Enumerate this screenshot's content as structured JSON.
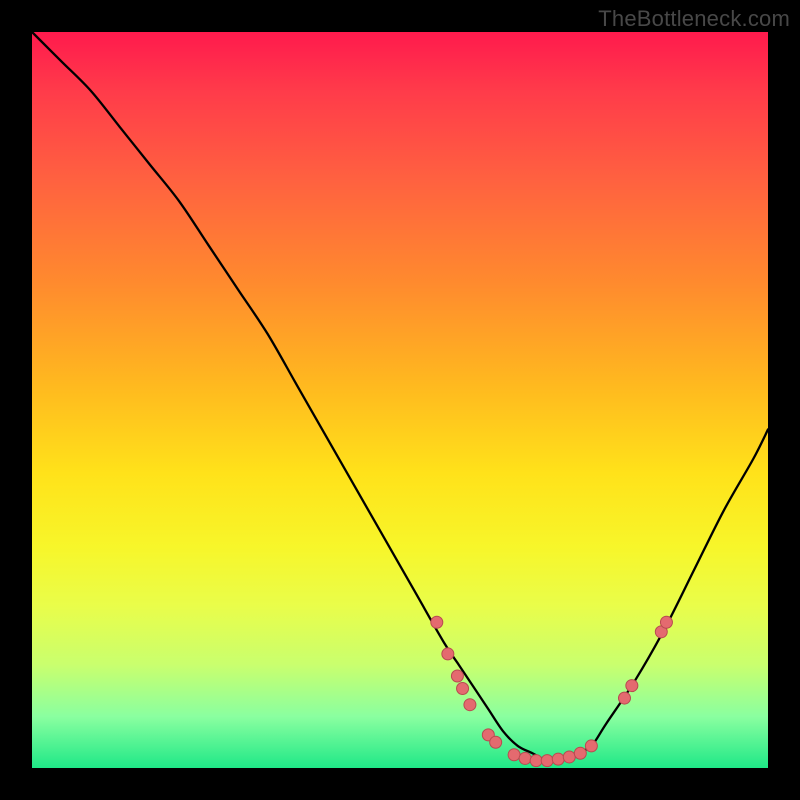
{
  "watermark": "TheBottleneck.com",
  "colors": {
    "page_bg": "#000000",
    "gradient_top": "#ff1a4d",
    "gradient_bottom": "#1fe887",
    "curve": "#000000",
    "dot_fill": "#e46a6f",
    "dot_stroke": "#b84a50"
  },
  "chart_data": {
    "type": "line",
    "title": "",
    "xlabel": "",
    "ylabel": "",
    "xlim": [
      0,
      100
    ],
    "ylim": [
      0,
      100
    ],
    "grid": false,
    "legend": false,
    "series": [
      {
        "name": "bottleneck-curve",
        "x": [
          0,
          4,
          8,
          12,
          16,
          20,
          24,
          28,
          32,
          36,
          40,
          44,
          48,
          52,
          56,
          58,
          60,
          62,
          64,
          66,
          68,
          70,
          72,
          74,
          76,
          78,
          82,
          86,
          90,
          94,
          98,
          100
        ],
        "y": [
          100,
          96,
          92,
          87,
          82,
          77,
          71,
          65,
          59,
          52,
          45,
          38,
          31,
          24,
          17,
          14,
          11,
          8,
          5,
          3,
          2,
          1,
          1,
          2,
          3,
          6,
          12,
          19,
          27,
          35,
          42,
          46
        ]
      }
    ],
    "markers": [
      {
        "x": 55.0,
        "y": 19.8
      },
      {
        "x": 56.5,
        "y": 15.5
      },
      {
        "x": 57.8,
        "y": 12.5
      },
      {
        "x": 58.5,
        "y": 10.8
      },
      {
        "x": 59.5,
        "y": 8.6
      },
      {
        "x": 62.0,
        "y": 4.5
      },
      {
        "x": 63.0,
        "y": 3.5
      },
      {
        "x": 65.5,
        "y": 1.8
      },
      {
        "x": 67.0,
        "y": 1.3
      },
      {
        "x": 68.5,
        "y": 1.0
      },
      {
        "x": 70.0,
        "y": 1.0
      },
      {
        "x": 71.5,
        "y": 1.2
      },
      {
        "x": 73.0,
        "y": 1.5
      },
      {
        "x": 74.5,
        "y": 2.0
      },
      {
        "x": 76.0,
        "y": 3.0
      },
      {
        "x": 80.5,
        "y": 9.5
      },
      {
        "x": 81.5,
        "y": 11.2
      },
      {
        "x": 85.5,
        "y": 18.5
      },
      {
        "x": 86.2,
        "y": 19.8
      }
    ],
    "marker_radius_px": 6
  }
}
